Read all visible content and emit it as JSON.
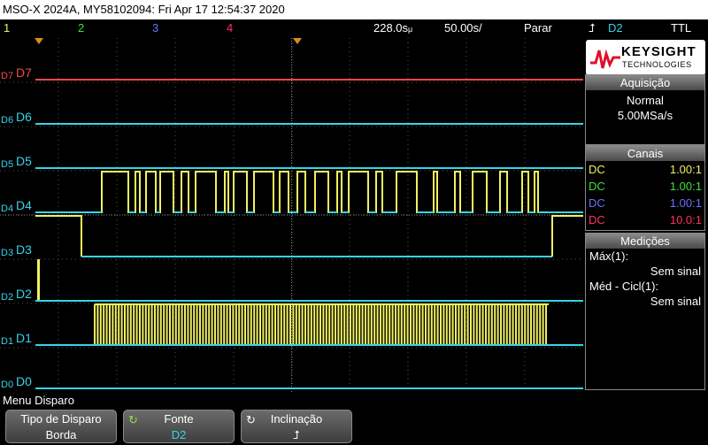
{
  "title": "MSO-X 2024A, MY58102094: Fri Apr 17 12:54:37 2020",
  "status": {
    "channels": [
      {
        "label": "1",
        "color": "#f0f060"
      },
      {
        "label": "2",
        "color": "#40e040"
      },
      {
        "label": "3",
        "color": "#6a70ff"
      },
      {
        "label": "4",
        "color": "#ff3060"
      }
    ],
    "time_scale": "228.0s",
    "time_unit_prefix": "μ",
    "delay": "50.00s",
    "delay_unit": "/",
    "run_state": "Parar",
    "trigger_source": "D2",
    "trigger_level": "TTL"
  },
  "colors": {
    "digital": "#35d4e8",
    "d7": "#f04a4a",
    "yellow": "#f0f060",
    "grid": "#555555"
  },
  "digital_channels": [
    {
      "label": "D7",
      "tick": "D7"
    },
    {
      "label": "D6",
      "tick": "D6"
    },
    {
      "label": "D5",
      "tick": "D5"
    },
    {
      "label": "D4",
      "tick": "D4"
    },
    {
      "label": "D3",
      "tick": "D3"
    },
    {
      "label": "D2",
      "tick": "D2"
    },
    {
      "label": "D1",
      "tick": "D1"
    },
    {
      "label": "D0",
      "tick": "D0"
    }
  ],
  "brand": {
    "name": "KEYSIGHT",
    "sub": "TECHNOLOGIES"
  },
  "acquisition": {
    "header": "Aquisição",
    "mode": "Normal",
    "rate": "5.00MSa/s"
  },
  "channels_panel": {
    "header": "Canais",
    "rows": [
      {
        "coupling": "DC",
        "scale": "1.00:1",
        "color": "#f0f060"
      },
      {
        "coupling": "DC",
        "scale": "1.00:1",
        "color": "#40e040"
      },
      {
        "coupling": "DC",
        "scale": "1.00:1",
        "color": "#6a70ff"
      },
      {
        "coupling": "DC",
        "scale": "10.0:1",
        "color": "#ff3060"
      }
    ]
  },
  "measurements": {
    "header": "Medições",
    "items": [
      {
        "name": "Máx(1):",
        "value": "Sem sinal"
      },
      {
        "name": "Méd - Cicl(1):",
        "value": "Sem sinal"
      }
    ]
  },
  "menu": {
    "title": "Menu Disparo",
    "softkeys": [
      {
        "label": "Tipo de Disparo",
        "value": "Borda",
        "icon": ""
      },
      {
        "label": "Fonte",
        "value": "D2",
        "icon": "↻"
      },
      {
        "label": "Inclinação",
        "value": "⮥",
        "icon": "↻"
      }
    ]
  }
}
